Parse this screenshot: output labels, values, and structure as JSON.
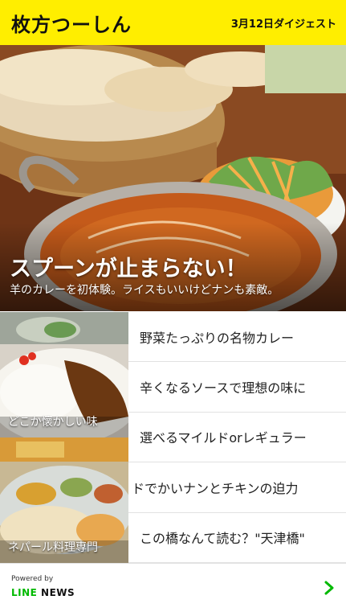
{
  "header": {
    "logo": "枚方つーしん",
    "digest": "3月12日ダイジェスト"
  },
  "hero": {
    "title": "スプーンが止まらない！",
    "subtitle": "羊のカレーを初体験。ライスもいいけどナンも素敵。"
  },
  "thumbnails": [
    {
      "caption": "どこか懐かしい味"
    },
    {
      "caption": "ネパール料理専門"
    }
  ],
  "list": {
    "items": [
      "野菜たっぷりの名物カレー",
      "辛くなるソースで理想の味に",
      "選べるマイルドorレギュラー",
      "ドでかいナンとチキンの迫力",
      "この橋なんて読む？\"天津橋\""
    ]
  },
  "footer": {
    "powered_by": "Powered by",
    "brand_line": "LINE",
    "brand_news": "NEWS",
    "chevron_icon": "chevron-right-icon",
    "accent": "#00b900"
  },
  "colors": {
    "header_bg": "#ffee00"
  }
}
